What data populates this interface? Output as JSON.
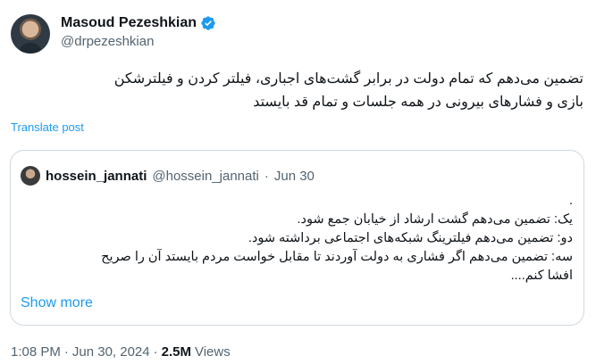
{
  "author": {
    "display_name": "Masoud Pezeshkian",
    "handle": "@drpezeshkian"
  },
  "tweet": {
    "lines": [
      "تضمین می‌دهم که تمام دولت در برابر  گشت‌های اجباری، فیلتر کردن و فیلترشکن",
      "بازی و فشارهای بیرونی در همه جلسات و تمام قد بایستد"
    ],
    "translate_label": "Translate post"
  },
  "quote": {
    "name": "hossein_jannati",
    "handle": "@hossein_jannati",
    "separator": "·",
    "date": "Jun 30",
    "lines": [
      ".",
      "یک: تضمین می‌دهم گشت ارشاد از خیابان جمع شود.",
      "دو: تضمین می‌دهم فیلترینگ شبکه‌های اجتماعی برداشته شود.",
      "سه: تضمین می‌دهم اگر فشاری به دولت آوردند تا مقابل خواست مردم بایستد آن را صریح",
      "افشا کنم...."
    ],
    "show_more_label": "Show more"
  },
  "footer": {
    "time": "1:08 PM",
    "separator": "·",
    "date": "Jun 30, 2024",
    "separator2": "·",
    "views_count": "2.5M",
    "views_label": "Views"
  },
  "colors": {
    "link": "#1d9bf0",
    "secondary_text": "#536471",
    "border": "#cfd9de",
    "verified": "#1d9bf0"
  }
}
